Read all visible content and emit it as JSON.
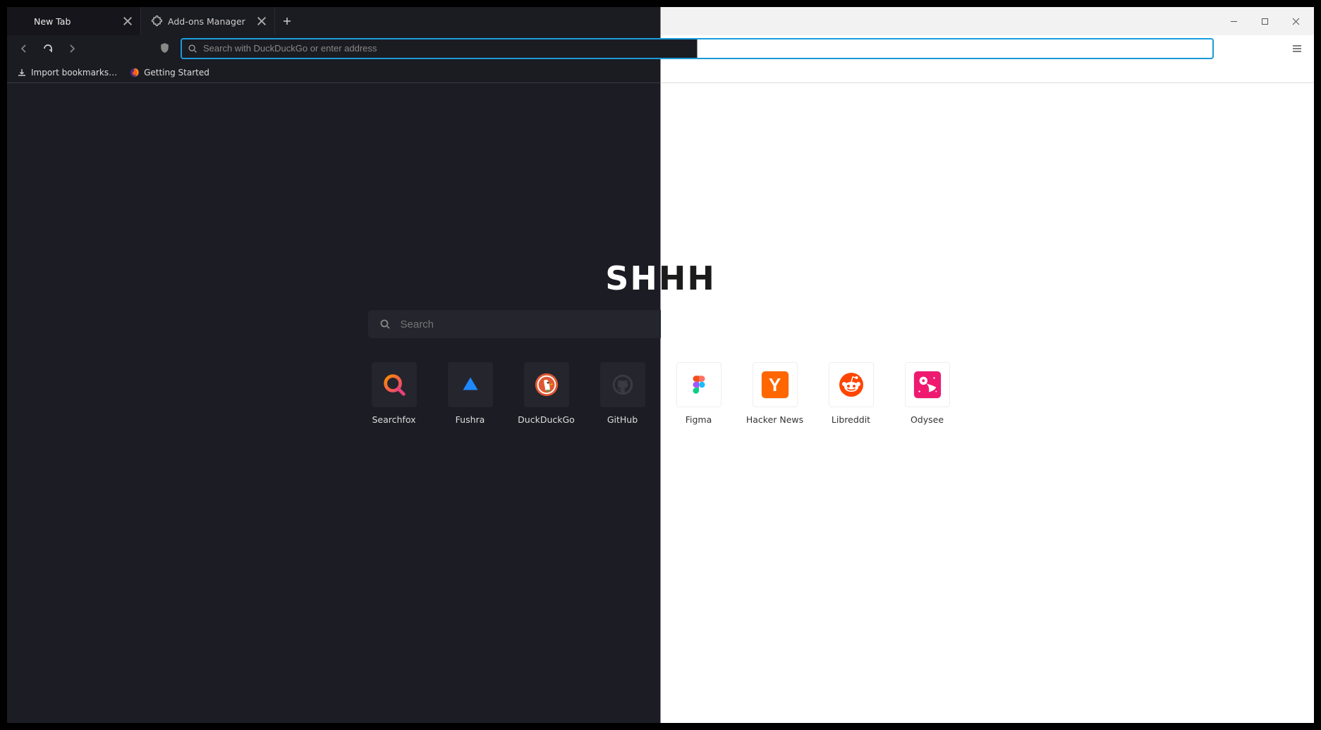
{
  "tabs": [
    {
      "label": "New Tab",
      "icon": null,
      "active": true
    },
    {
      "label": "Add-ons Manager",
      "icon": "puzzle",
      "active": false
    }
  ],
  "urlbar": {
    "placeholder": "Search with DuckDuckGo or enter address"
  },
  "bookmarks": [
    {
      "label": "Import bookmarks…",
      "icon": "import"
    },
    {
      "label": "Getting Started",
      "icon": "firefox"
    }
  ],
  "newtab": {
    "brand": "SHHH",
    "search_placeholder": "Search",
    "tiles": [
      {
        "label": "Searchfox",
        "theme": "dark",
        "icon": "searchfox"
      },
      {
        "label": "Fushra",
        "theme": "dark",
        "icon": "fushra"
      },
      {
        "label": "DuckDuckGo",
        "theme": "dark",
        "icon": "ddg"
      },
      {
        "label": "GitHub",
        "theme": "dark",
        "icon": "github"
      },
      {
        "label": "Figma",
        "theme": "light",
        "icon": "figma"
      },
      {
        "label": "Hacker News",
        "theme": "light",
        "icon": "hn"
      },
      {
        "label": "Libreddit",
        "theme": "light",
        "icon": "reddit"
      },
      {
        "label": "Odysee",
        "theme": "light",
        "icon": "odysee"
      }
    ]
  }
}
